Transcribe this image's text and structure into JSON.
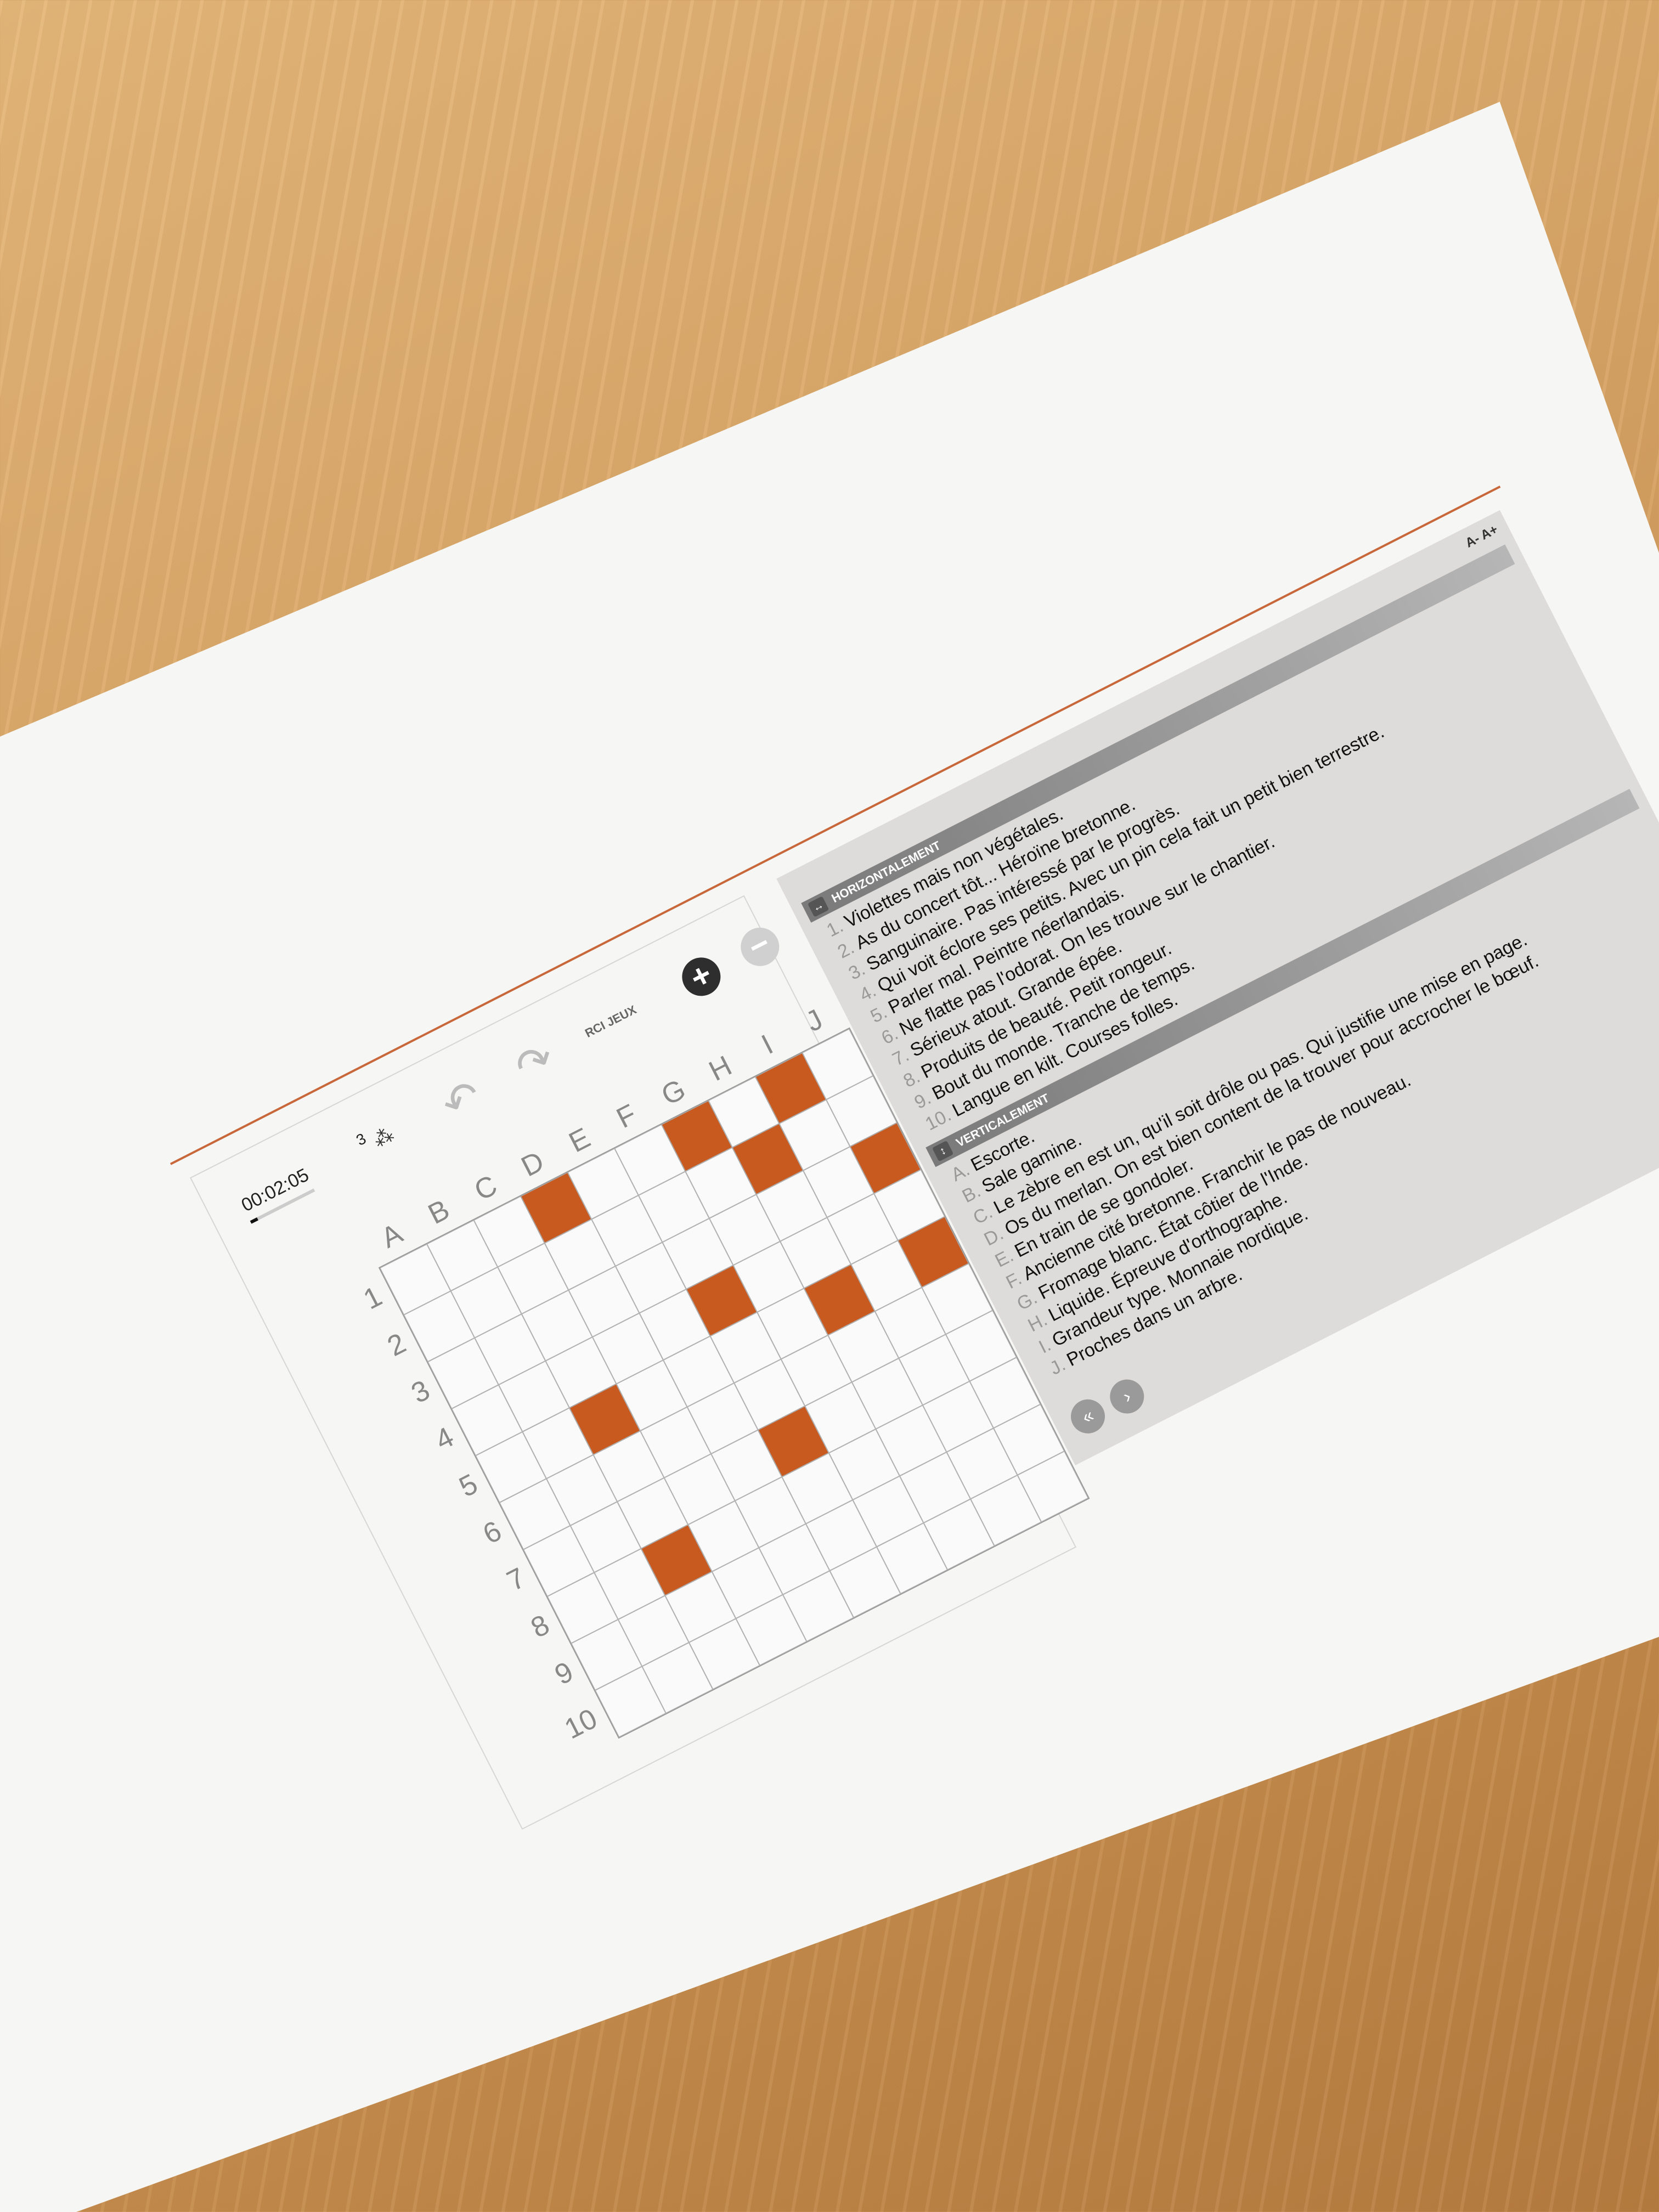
{
  "game": {
    "timer": "00:02:05",
    "hint_count": "3",
    "brand": "RCI JEUX",
    "columns": [
      "A",
      "B",
      "C",
      "D",
      "E",
      "F",
      "G",
      "H",
      "I",
      "J"
    ],
    "rows": [
      "1",
      "2",
      "3",
      "4",
      "5",
      "6",
      "7",
      "8",
      "9",
      "10"
    ],
    "black_cells": [
      [
        1,
        4
      ],
      [
        1,
        7
      ],
      [
        1,
        9
      ],
      [
        2,
        8
      ],
      [
        3,
        10
      ],
      [
        4,
        6
      ],
      [
        5,
        3
      ],
      [
        5,
        8
      ],
      [
        5,
        10
      ],
      [
        7,
        6
      ],
      [
        8,
        3
      ],
      [
        0,
        0
      ]
    ]
  },
  "clues": {
    "font_minus": "A-",
    "font_plus": "A+",
    "horizontal_title": "HORIZONTALEMENT",
    "horizontal": [
      {
        "n": "1.",
        "text": "Violettes mais non végétales."
      },
      {
        "n": "2.",
        "text": "As du concert tôt... Héroïne bretonne."
      },
      {
        "n": "3.",
        "text": "Sanguinaire. Pas intéressé par le progrès."
      },
      {
        "n": "4.",
        "text": "Qui voit éclore ses petits. Avec un pin cela fait un petit bien terrestre."
      },
      {
        "n": "5.",
        "text": "Parler mal. Peintre néerlandais."
      },
      {
        "n": "6.",
        "text": "Ne flatte pas l'odorat. On les trouve sur le chantier."
      },
      {
        "n": "7.",
        "text": "Sérieux atout. Grande épée."
      },
      {
        "n": "8.",
        "text": "Produits de beauté. Petit rongeur."
      },
      {
        "n": "9.",
        "text": "Bout du monde. Tranche de temps."
      },
      {
        "n": "10.",
        "text": "Langue en kilt. Courses folles."
      }
    ],
    "vertical_title": "VERTICALEMENT",
    "vertical": [
      {
        "n": "A.",
        "text": "Escorte."
      },
      {
        "n": "B.",
        "text": "Sale gamine."
      },
      {
        "n": "C.",
        "text": "Le zèbre en est un, qu'il soit drôle ou pas. Qui justifie une mise en page."
      },
      {
        "n": "D.",
        "text": "Os du merlan. On est bien content de la trouver pour accrocher le bœuf."
      },
      {
        "n": "E.",
        "text": "En train de se gondoler."
      },
      {
        "n": "F.",
        "text": "Ancienne cité bretonne. Franchir le pas de nouveau."
      },
      {
        "n": "G.",
        "text": "Fromage blanc. État côtier de l'Inde."
      },
      {
        "n": "H.",
        "text": "Liquide. Épreuve d'orthographe."
      },
      {
        "n": "I.",
        "text": "Grandeur type. Monnaie nordique."
      },
      {
        "n": "J.",
        "text": "Proches dans un arbre."
      }
    ]
  }
}
